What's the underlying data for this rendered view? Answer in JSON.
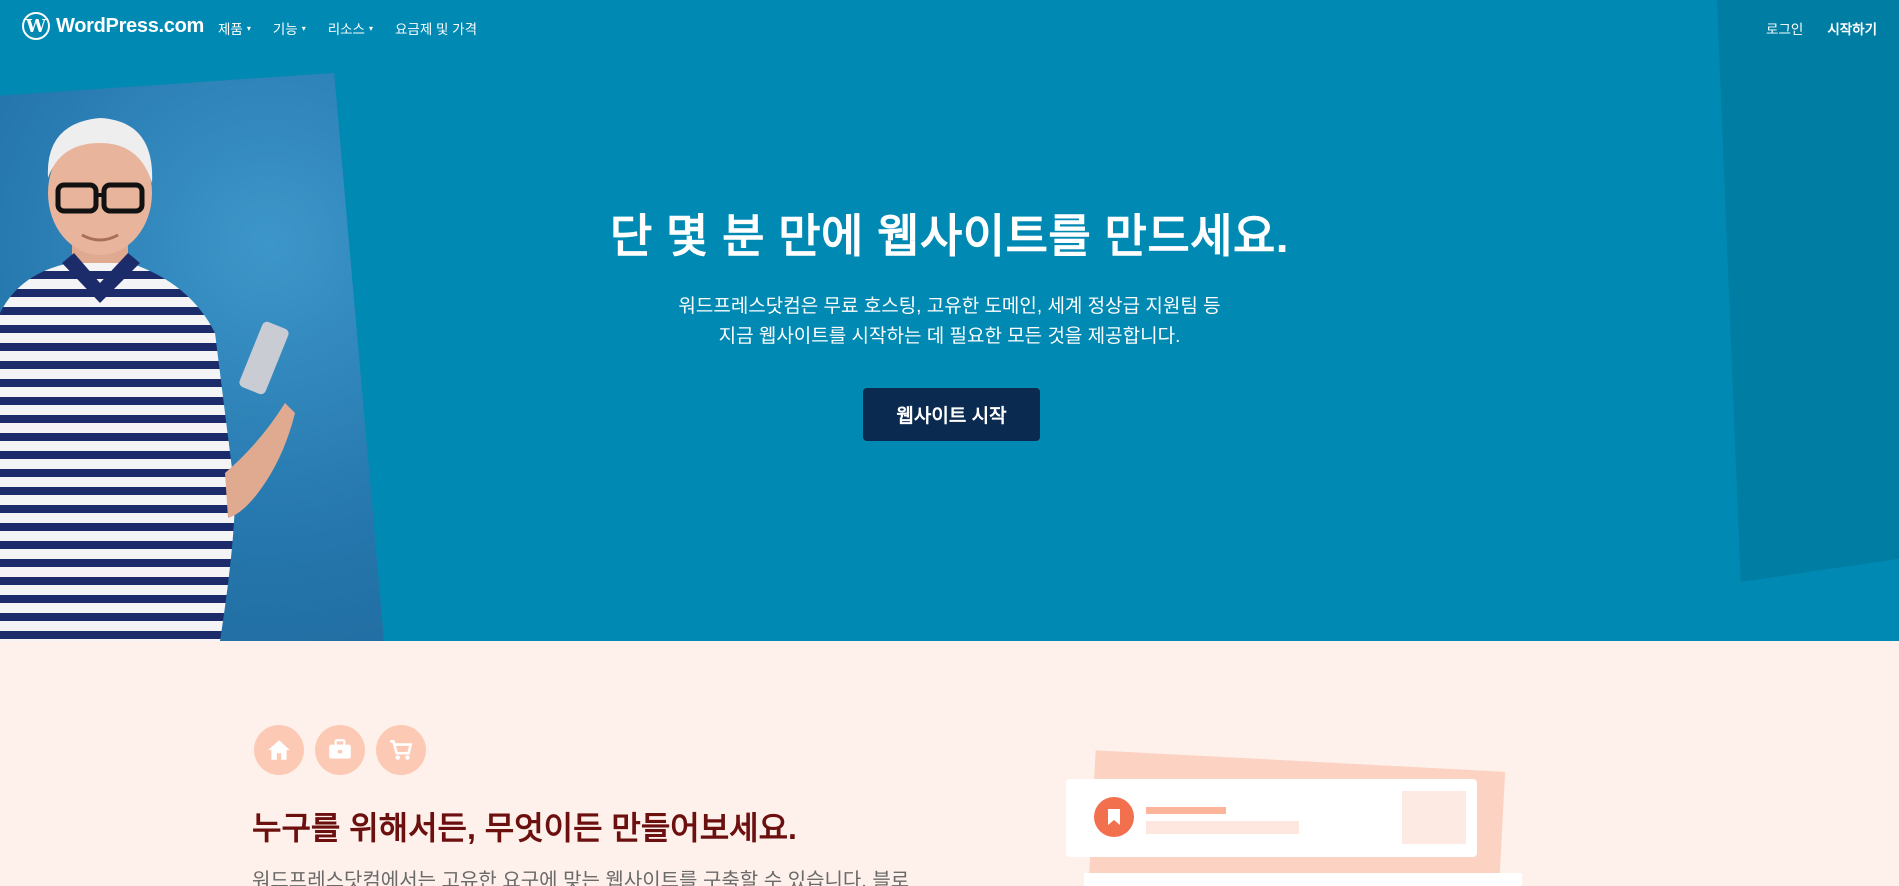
{
  "brand": {
    "name": "WordPress.com",
    "logo_letter": "W"
  },
  "nav": {
    "menu": [
      {
        "label": "제품",
        "has_dropdown": true
      },
      {
        "label": "기능",
        "has_dropdown": true
      },
      {
        "label": "리소스",
        "has_dropdown": true
      },
      {
        "label": "요금제 및 가격",
        "has_dropdown": false
      }
    ],
    "login": "로그인",
    "get_started": "시작하기",
    "caret": "▾"
  },
  "hero": {
    "title": "단 몇 분 만에 웹사이트를 만드세요.",
    "subtitle_line1": "워드프레스닷컴은 무료 호스팅, 고유한 도메인, 세계 정상급 지원팀 등",
    "subtitle_line2": "지금 웹사이트를 시작하는 데 필요한 모든 것을 제공합니다.",
    "cta": "웹사이트 시작"
  },
  "section": {
    "icons": [
      "home-icon",
      "briefcase-icon",
      "cart-icon"
    ],
    "title": "누구를 위해서든, 무엇이든 만들어보세요.",
    "body": "워드프레스닷컴에서는 고유한 요구에 맞는 웹사이트를 구축할 수 있습니다. 블로"
  },
  "colors": {
    "hero_bg": "#008ab3",
    "cta_bg": "#0b2a4f",
    "section_bg": "#fef0ea",
    "section_title": "#6b0f0f",
    "icon_circle": "#fcc9b5",
    "accent": "#f2704d"
  }
}
